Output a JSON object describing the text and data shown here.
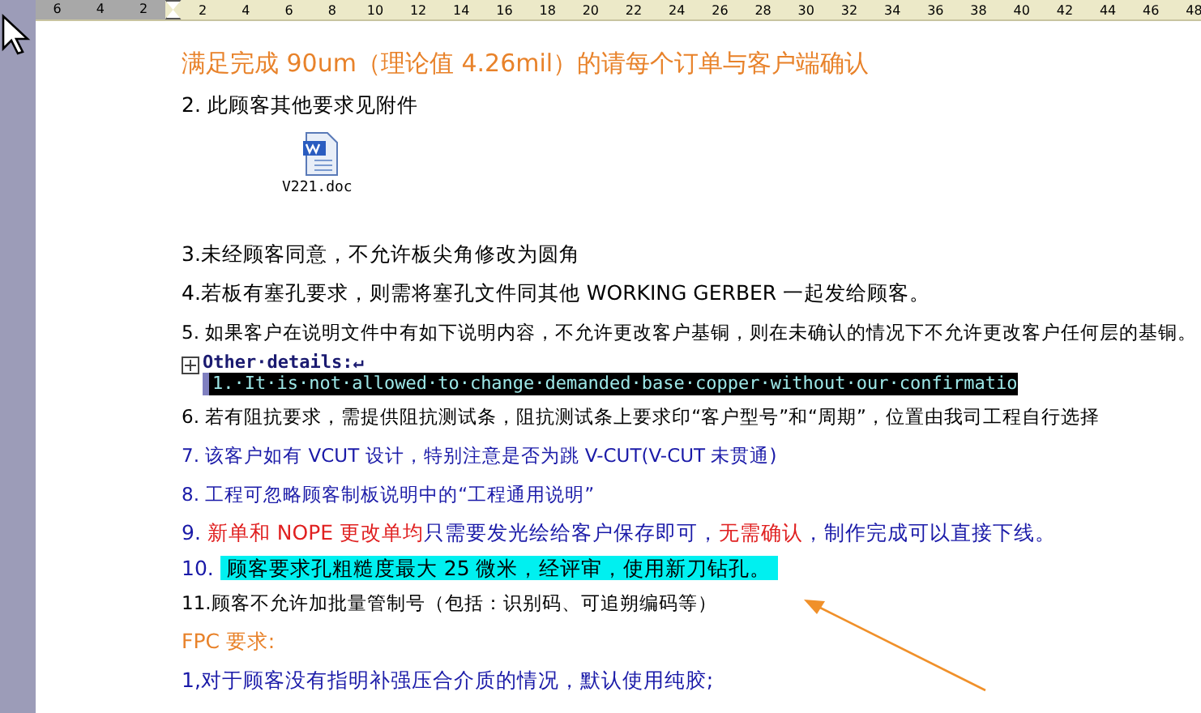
{
  "ruler": {
    "left_labels": [
      "6",
      "4",
      "2"
    ],
    "labels": [
      "2",
      "4",
      "6",
      "8",
      "10",
      "12",
      "14",
      "16",
      "18",
      "20",
      "22",
      "24",
      "26",
      "28",
      "30",
      "32",
      "34",
      "36",
      "38",
      "40",
      "42",
      "44",
      "46",
      "48"
    ]
  },
  "paragraphs": [
    {
      "kind": "heading",
      "segments": [
        {
          "text": "满足完成 90um（理论值 4.26mil）的请每个订单与客户端确认",
          "color": "#e8822a"
        }
      ]
    },
    {
      "kind": "text",
      "segments": [
        {
          "text": "2.   此顾客其他要求见附件",
          "color": "#000000"
        }
      ]
    },
    {
      "kind": "attachment",
      "label": "V221.doc"
    },
    {
      "kind": "text",
      "segments": [
        {
          "text": "3.未经顾客同意，不允许板尖角修改为圆角",
          "color": "#000000"
        }
      ]
    },
    {
      "kind": "text",
      "segments": [
        {
          "text": "4.若板有塞孔要求，则需将塞孔文件同其他 WORKING GERBER 一起发给顾客。",
          "color": "#000000"
        }
      ]
    },
    {
      "kind": "small",
      "segments": [
        {
          "text": "5.  如果客户在说明文件中有如下说明内容，不允许更改客户基铜，则在未确认的情况下不允许更改客户任何层的基铜。",
          "color": "#000000"
        }
      ]
    },
    {
      "kind": "code",
      "title": "Other·details:↵",
      "line": "1.·It·is·not·allowed·to·change·demanded·base·copper·without·our·confirmatio"
    },
    {
      "kind": "small",
      "segments": [
        {
          "text": "6.  若有阻抗要求，需提供阻抗测试条，阻抗测试条上要求印“客户型号”和“周期”，位置由我司工程自行选择",
          "color": "#000000"
        }
      ]
    },
    {
      "kind": "small",
      "segments": [
        {
          "text": "7.  该客户如有 VCUT 设计，特别注意是否为跳 V-CUT(V-CUT 未贯通)",
          "color": "#1a1aa8"
        }
      ]
    },
    {
      "kind": "small",
      "segments": [
        {
          "text": "8.  工程可忽略顾客制板说明中的“工程通用说明”",
          "color": "#1a1aa8"
        }
      ]
    },
    {
      "kind": "text",
      "segments": [
        {
          "text": "9.  ",
          "color": "#1a1aa8"
        },
        {
          "text": "新单和 NOPE 更改单均",
          "color": "#e02020"
        },
        {
          "text": "只需要发光绘给客户保存即可，",
          "color": "#1a1aa8"
        },
        {
          "text": "无需确认",
          "color": "#e02020"
        },
        {
          "text": "，制作完成可以直接下线。",
          "color": "#1a1aa8"
        }
      ]
    },
    {
      "kind": "highlight",
      "label": "10.",
      "text": "顾客要求孔粗糙度最大 25 微米，经评审，使用新刀钻孔。"
    },
    {
      "kind": "small",
      "segments": [
        {
          "text": "11.顾客不允许加批量管制号（包括：识别码、可追朔编码等）",
          "color": "#000000"
        }
      ]
    },
    {
      "kind": "text",
      "segments": [
        {
          "text": "FPC 要求:",
          "color": "#e8822a"
        }
      ]
    },
    {
      "kind": "text",
      "segments": [
        {
          "text": "1,对于顾客没有指明补强压合介质的情况，默认使用纯胶;",
          "color": "#1a1aa8"
        }
      ]
    }
  ]
}
